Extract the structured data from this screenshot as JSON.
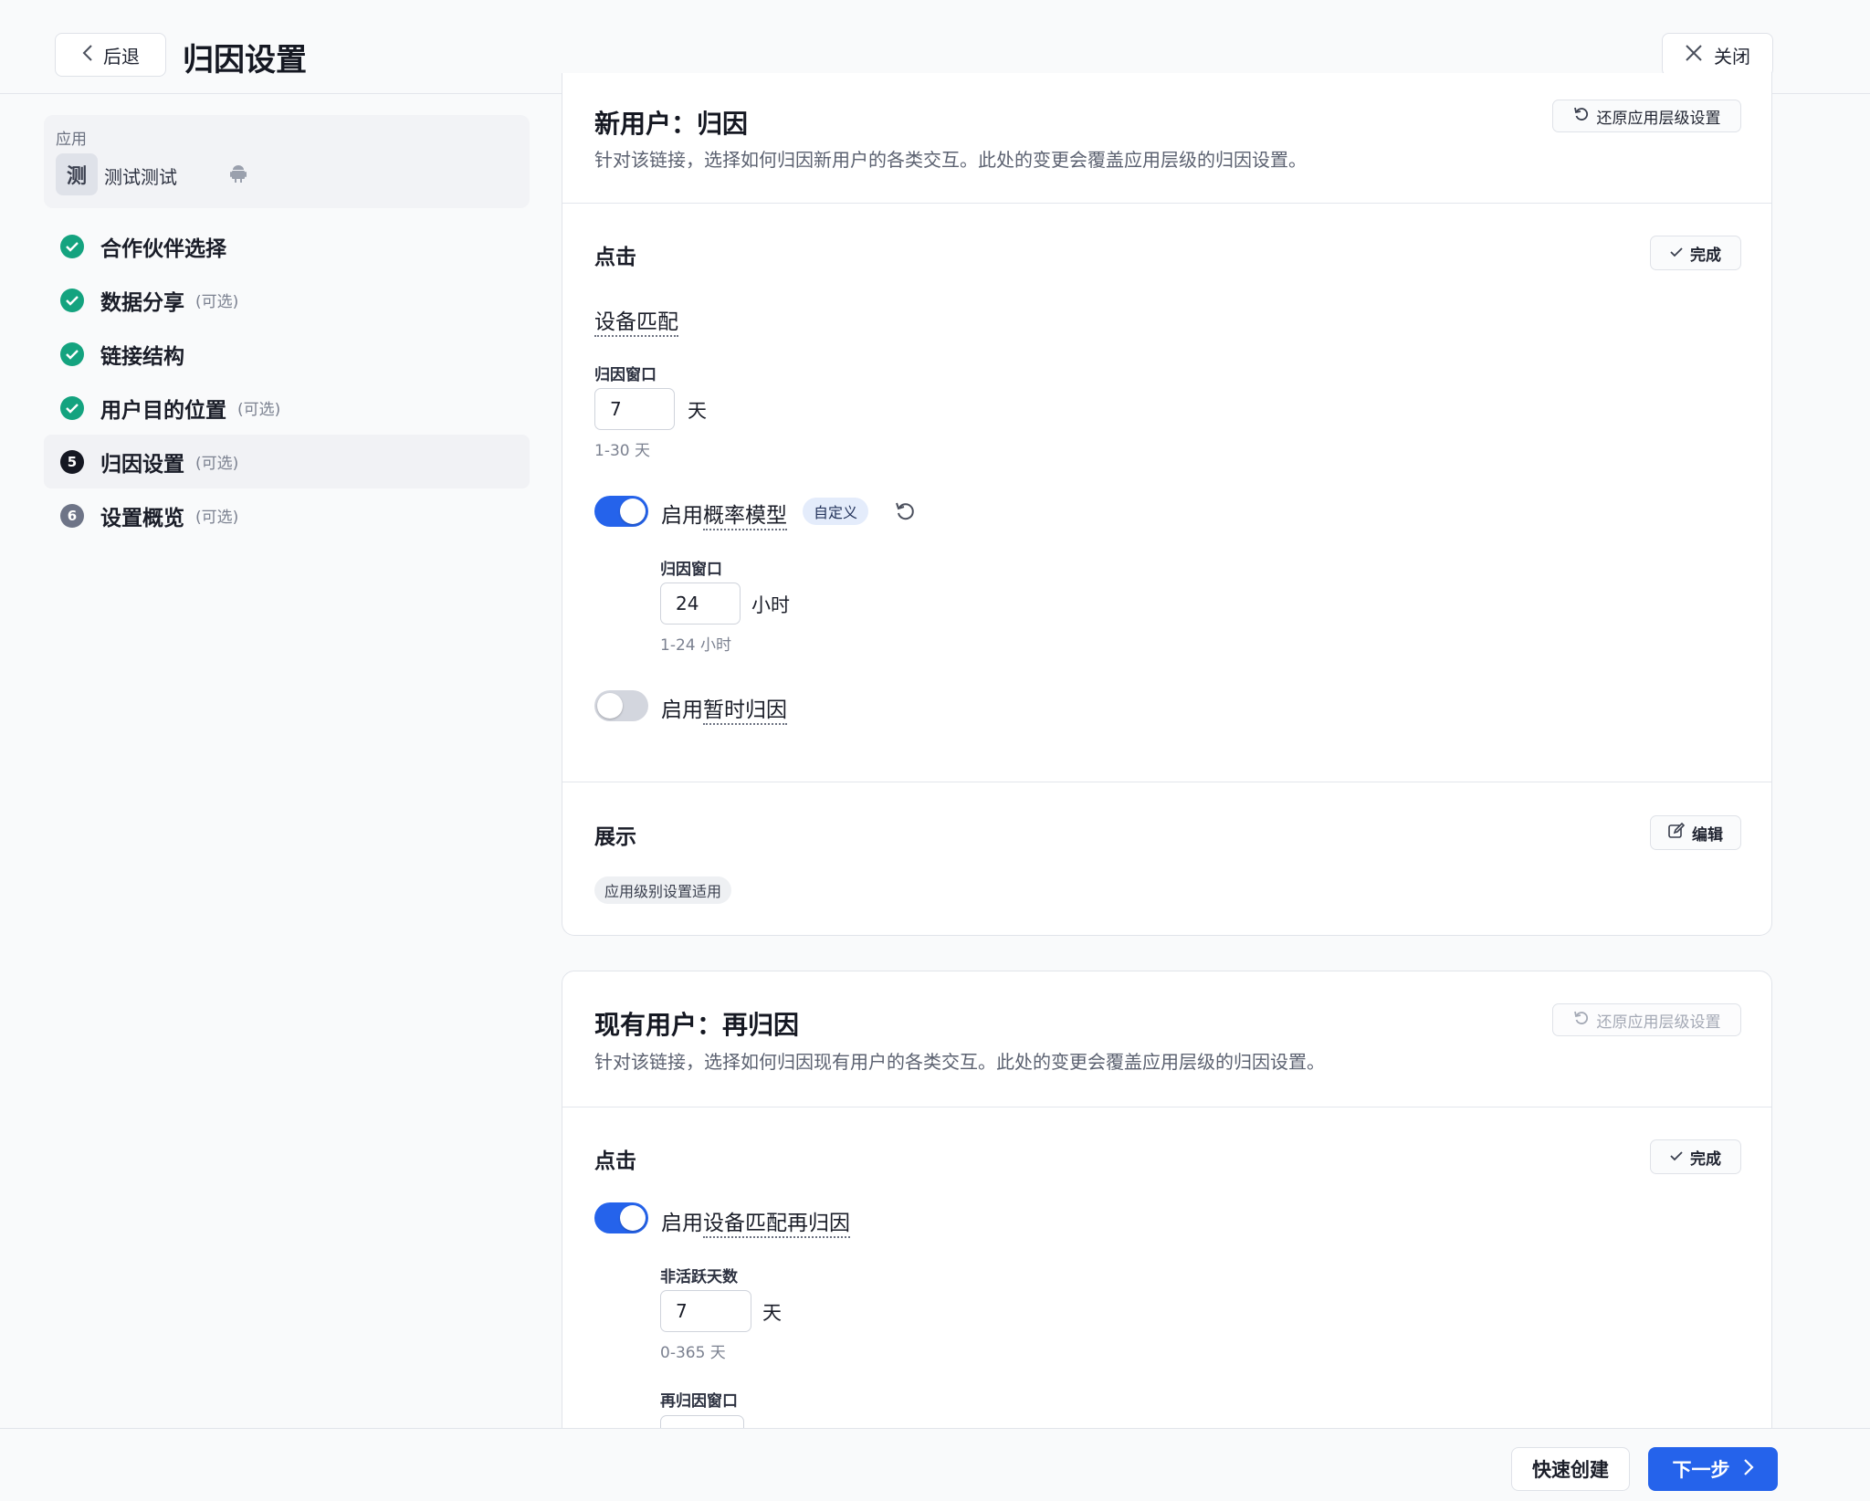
{
  "header": {
    "back_label": "后退",
    "title": "归因设置",
    "close_label": "关闭"
  },
  "sidebar": {
    "app_label": "应用",
    "app_avatar": "测",
    "app_name": "测试测试",
    "app_platform_icon": "android-icon",
    "steps": [
      {
        "icon": "check",
        "label": "合作伙伴选择",
        "optional": ""
      },
      {
        "icon": "check",
        "label": "数据分享",
        "optional": "(可选)"
      },
      {
        "icon": "check",
        "label": "链接结构",
        "optional": ""
      },
      {
        "icon": "check",
        "label": "用户目的位置",
        "optional": "(可选)"
      },
      {
        "icon": "5",
        "label": "归因设置",
        "optional": "(可选)"
      },
      {
        "icon": "6",
        "label": "设置概览",
        "optional": "(可选)"
      }
    ]
  },
  "new_user": {
    "title": "新用户：归因",
    "description": "针对该链接，选择如何归因新用户的各类交互。此处的变更会覆盖应用层级的归因设置。",
    "restore_label": "还原应用层级设置",
    "click": {
      "title": "点击",
      "done_label": "完成",
      "device_match_label": "设备匹配",
      "window_label": "归因窗口",
      "window_value": "7",
      "window_unit": "天",
      "window_hint": "1-30 天",
      "probabilistic": {
        "prefix": "启用",
        "term": "概率模型",
        "enabled": true,
        "badge": "自定义",
        "window_label": "归因窗口",
        "window_value": "24",
        "window_unit": "小时",
        "window_hint": "1-24 小时"
      },
      "temporary": {
        "prefix": "启用",
        "term": "暂时归因",
        "enabled": false
      }
    },
    "view": {
      "title": "展示",
      "edit_label": "编辑",
      "pill": "应用级别设置适用"
    }
  },
  "existing_user": {
    "title": "现有用户：再归因",
    "description": "针对该链接，选择如何归因现有用户的各类交互。此处的变更会覆盖应用层级的归因设置。",
    "restore_label": "还原应用层级设置",
    "click": {
      "title": "点击",
      "done_label": "完成",
      "reattribution": {
        "prefix": "启用",
        "term": "设备匹配再归因",
        "enabled": true
      },
      "inactive_label": "非活跃天数",
      "inactive_value": "7",
      "inactive_unit": "天",
      "inactive_hint": "0-365 天",
      "reattr_window_label": "再归因窗口"
    }
  },
  "footer": {
    "quick_label": "快速创建",
    "next_label": "下一步"
  },
  "colors": {
    "primary": "#2563eb",
    "success": "#14a37f",
    "toggle_off": "#d3d6de"
  }
}
